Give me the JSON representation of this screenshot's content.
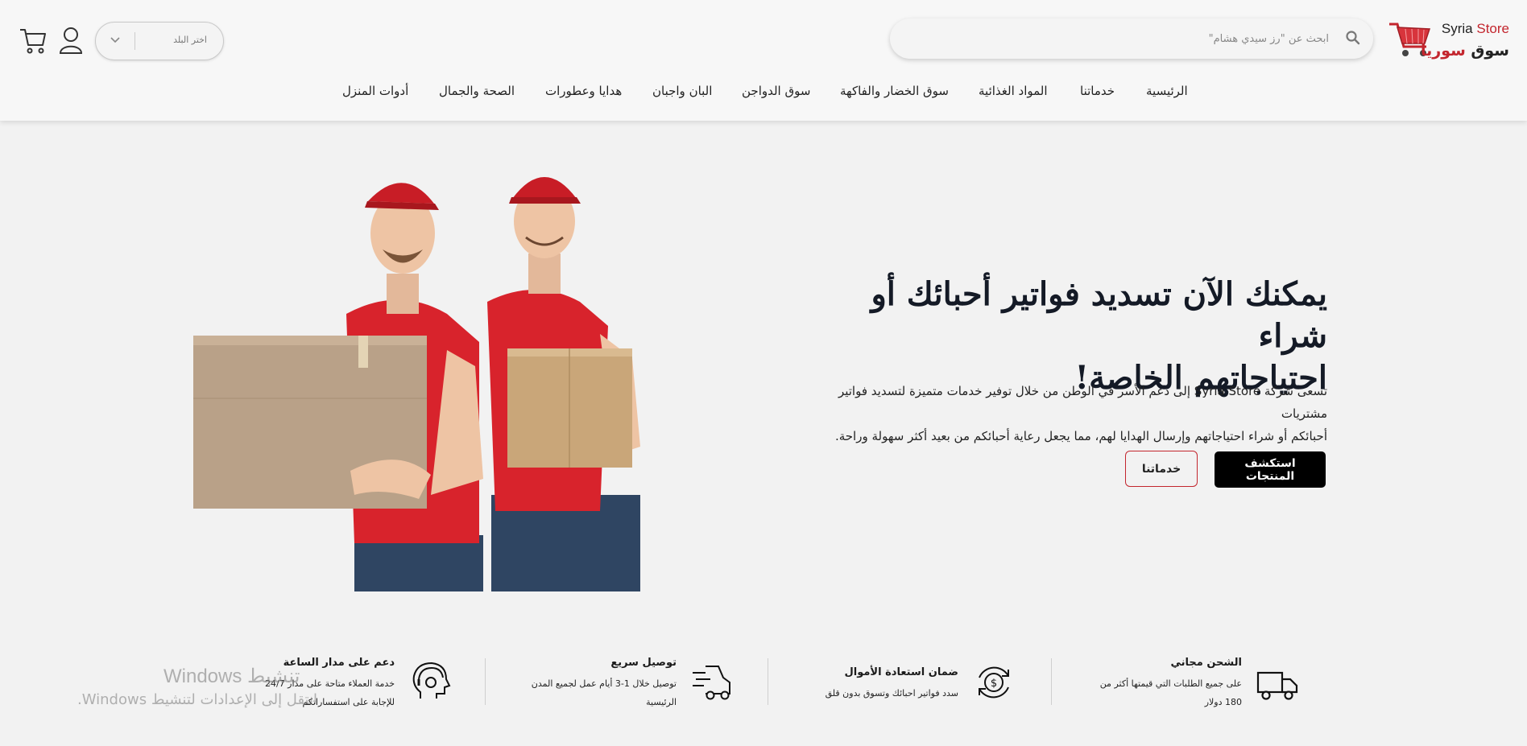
{
  "brand": {
    "name_en_prefix": "Syria ",
    "name_en_suffix": "Store",
    "name_ar_first": "سوق ",
    "name_ar_second": "سوريا",
    "accent_color": "#c3262e"
  },
  "search": {
    "placeholder": "ابحث عن \"رز سيدي هشام\"",
    "icon": "search-icon"
  },
  "country_select": {
    "label": "اختر البلد",
    "icon": "chevron-down-icon"
  },
  "header_icons": {
    "user": "user-icon",
    "cart": "cart-icon"
  },
  "nav": {
    "items": [
      {
        "label": "الرئيسية"
      },
      {
        "label": "خدماتنا"
      },
      {
        "label": "المواد الغذائية"
      },
      {
        "label": "سوق الخضار والفاكهة"
      },
      {
        "label": "سوق الدواجن"
      },
      {
        "label": "البان واجبان"
      },
      {
        "label": "هدايا وعطورات"
      },
      {
        "label": "الصحة والجمال"
      },
      {
        "label": "أدوات المنزل"
      }
    ]
  },
  "hero": {
    "title_line1": "يمكنك الآن تسديد فواتير أحبائك أو شراء",
    "title_line2": "احتياجاتهم الخاصة!",
    "desc_line1": "تسعى شركة Syria Store إلى دعم الأسر في الوطن من خلال توفير خدمات متميزة لتسديد فواتير مشتريات",
    "desc_line2": "أحبائكم أو شراء احتياجاتهم وإرسال الهدايا لهم، مما يجعل رعاية أحبائكم من بعيد أكثر سهولة وراحة.",
    "primary_button": "استكشف المنتجات",
    "secondary_button": "خدماتنا"
  },
  "features": [
    {
      "icon": "delivery-truck-icon",
      "title": "الشحن مجاني",
      "desc_line1": "على جميع الطلبات التي قيمتها أكثر من",
      "desc_line2": "180 دولار"
    },
    {
      "icon": "money-back-icon",
      "title": "ضمان استعادة الأموال",
      "desc_line1": "سدد فواتير احبائك وتسوق بدون قلق",
      "desc_line2": ""
    },
    {
      "icon": "fast-delivery-icon",
      "title": "توصيل سريع",
      "desc_line1": "توصيل خلال 1-3 أيام عمل لجميع المدن",
      "desc_line2": "الرئيسية"
    },
    {
      "icon": "support-headset-icon",
      "title": "دعم على مدار الساعة",
      "desc_line1": "خدمة العملاء متاحة على مدار 24/7",
      "desc_line2": "للإجابة على استفساراتكم"
    }
  ],
  "watermark": {
    "line1": "Windows تنشيط",
    "line2": "انتقل إلى الإعدادات لتنشيط Windows."
  }
}
